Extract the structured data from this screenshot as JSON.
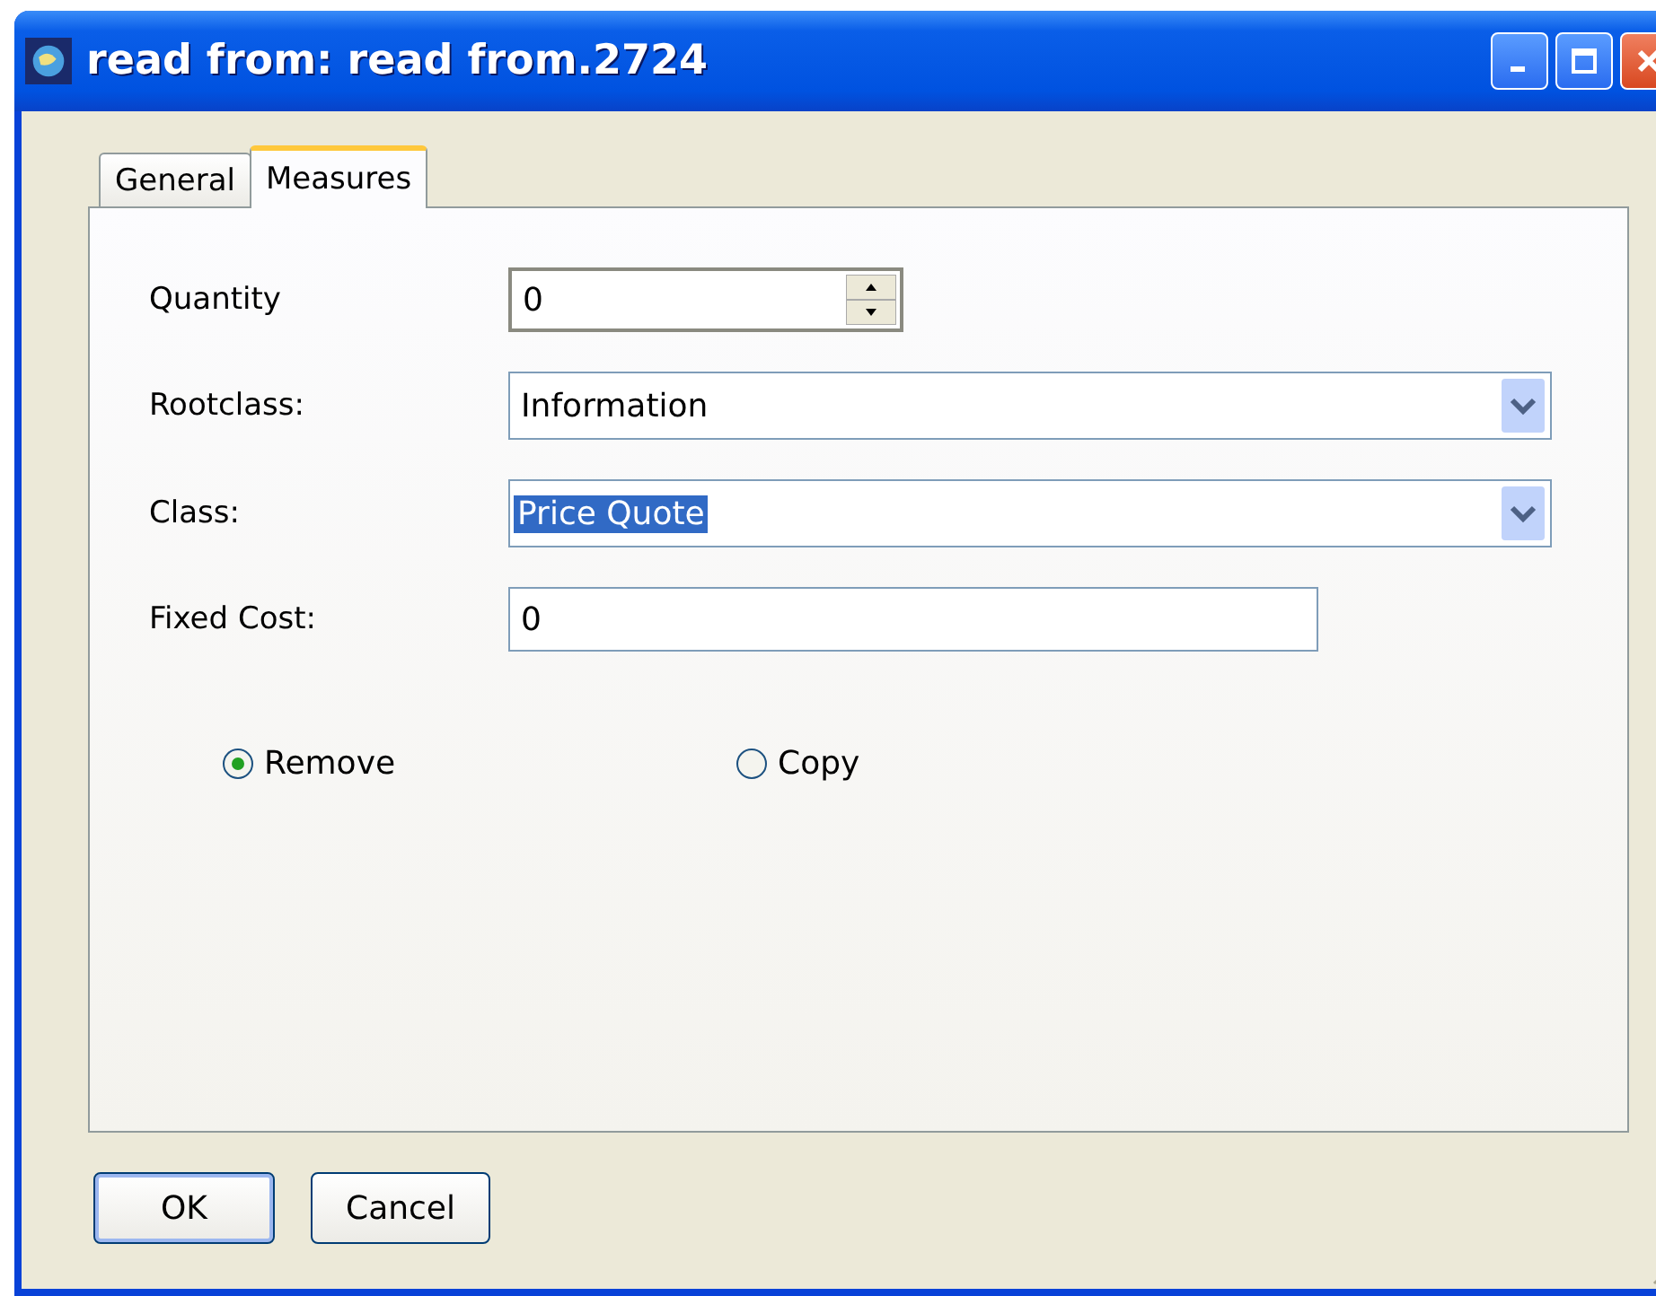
{
  "window": {
    "title": "read from: read from.2724"
  },
  "tabs": [
    {
      "label": "General",
      "selected": false
    },
    {
      "label": "Measures",
      "selected": true
    }
  ],
  "fields": [
    {
      "kind": "spin",
      "label": "Quantity",
      "value": "0",
      "highlighted": false
    },
    {
      "kind": "combo",
      "label": "Rootclass:",
      "value": "Information",
      "highlighted": false
    },
    {
      "kind": "combo",
      "label": "Class:",
      "value": "Price Quote",
      "highlighted": true
    },
    {
      "kind": "text",
      "label": "Fixed Cost:",
      "value": "0",
      "highlighted": false
    }
  ],
  "options": [
    {
      "label": "Remove",
      "selected": true
    },
    {
      "label": "Copy",
      "selected": false
    }
  ],
  "buttons": [
    {
      "label": "OK",
      "default": true
    },
    {
      "label": "Cancel",
      "default": false
    }
  ]
}
